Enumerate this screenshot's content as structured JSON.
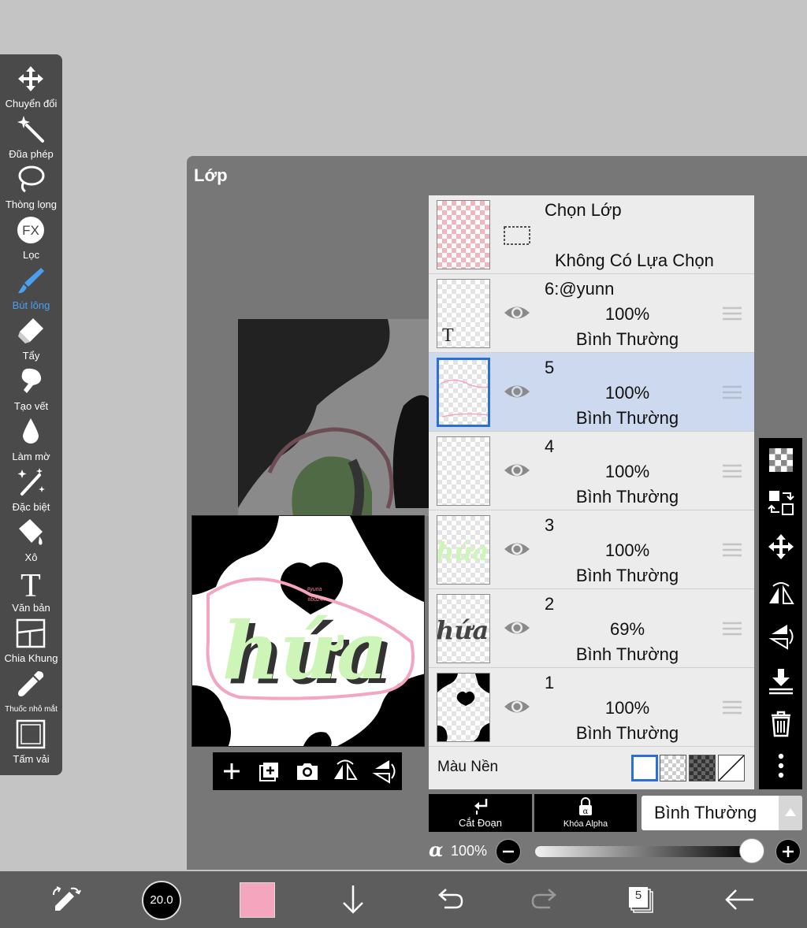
{
  "toolbar": {
    "tools": [
      {
        "label": "Chuyển đổi",
        "icon": "move-icon"
      },
      {
        "label": "Đũa phép",
        "icon": "magic-wand-icon"
      },
      {
        "label": "Thòng lọng",
        "icon": "lasso-icon"
      },
      {
        "label": "Lọc",
        "icon": "fx-icon"
      },
      {
        "label": "Bút lông",
        "icon": "brush-icon",
        "active": true
      },
      {
        "label": "Tẩy",
        "icon": "eraser-icon"
      },
      {
        "label": "Tạo vết",
        "icon": "smudge-icon"
      },
      {
        "label": "Làm mờ",
        "icon": "blur-icon"
      },
      {
        "label": "Đặc biệt",
        "icon": "special-brush-icon"
      },
      {
        "label": "Xô",
        "icon": "bucket-icon"
      },
      {
        "label": "Văn bản",
        "icon": "text-icon"
      },
      {
        "label": "Chia Khung",
        "icon": "frame-divider-icon"
      },
      {
        "label": "Thuốc nhỏ mắt",
        "icon": "eyedropper-icon"
      },
      {
        "label": "Tấm vải",
        "icon": "canvas-icon"
      }
    ],
    "fx_glyph": "FX",
    "text_glyph": "T"
  },
  "dialog": {
    "title": "Lớp"
  },
  "preview": {
    "artwork_text": "hứa",
    "tag_line1": "#yuna",
    "tag_line2": "#bd247"
  },
  "selection_row": {
    "title": "Chọn Lớp",
    "status": "Không Có Lựa Chọn"
  },
  "layers": [
    {
      "name": "6:@yunn",
      "opacity": "100%",
      "mode": "Bình Thường",
      "thumb": "text",
      "thumb_glyph": "T"
    },
    {
      "name": "5",
      "opacity": "100%",
      "mode": "Bình Thường",
      "thumb": "pink-line",
      "selected": true
    },
    {
      "name": "4",
      "opacity": "100%",
      "mode": "Bình Thường",
      "thumb": "empty"
    },
    {
      "name": "3",
      "opacity": "100%",
      "mode": "Bình Thường",
      "thumb": "green-text",
      "thumb_glyph": "hứa"
    },
    {
      "name": "2",
      "opacity": "69%",
      "mode": "Bình Thường",
      "thumb": "dark-text",
      "thumb_glyph": "hứa"
    },
    {
      "name": "1",
      "opacity": "100%",
      "mode": "Bình Thường",
      "thumb": "cow"
    }
  ],
  "background": {
    "label": "Màu Nền"
  },
  "blend": {
    "clip_label": "Cắt Đoạn",
    "alpha_lock_label": "Khóa Alpha",
    "mode_value": "Bình Thường"
  },
  "opacity": {
    "symbol": "α",
    "value": "100%",
    "level": 1.0
  },
  "bottom_bar": {
    "brush_size": "20.0",
    "layer_count": "5",
    "color": "#f4a6be"
  },
  "colors": {
    "accent": "#2a6fd6",
    "active_tool": "#4a9ff0",
    "selected_row": "#cdd9ee"
  }
}
